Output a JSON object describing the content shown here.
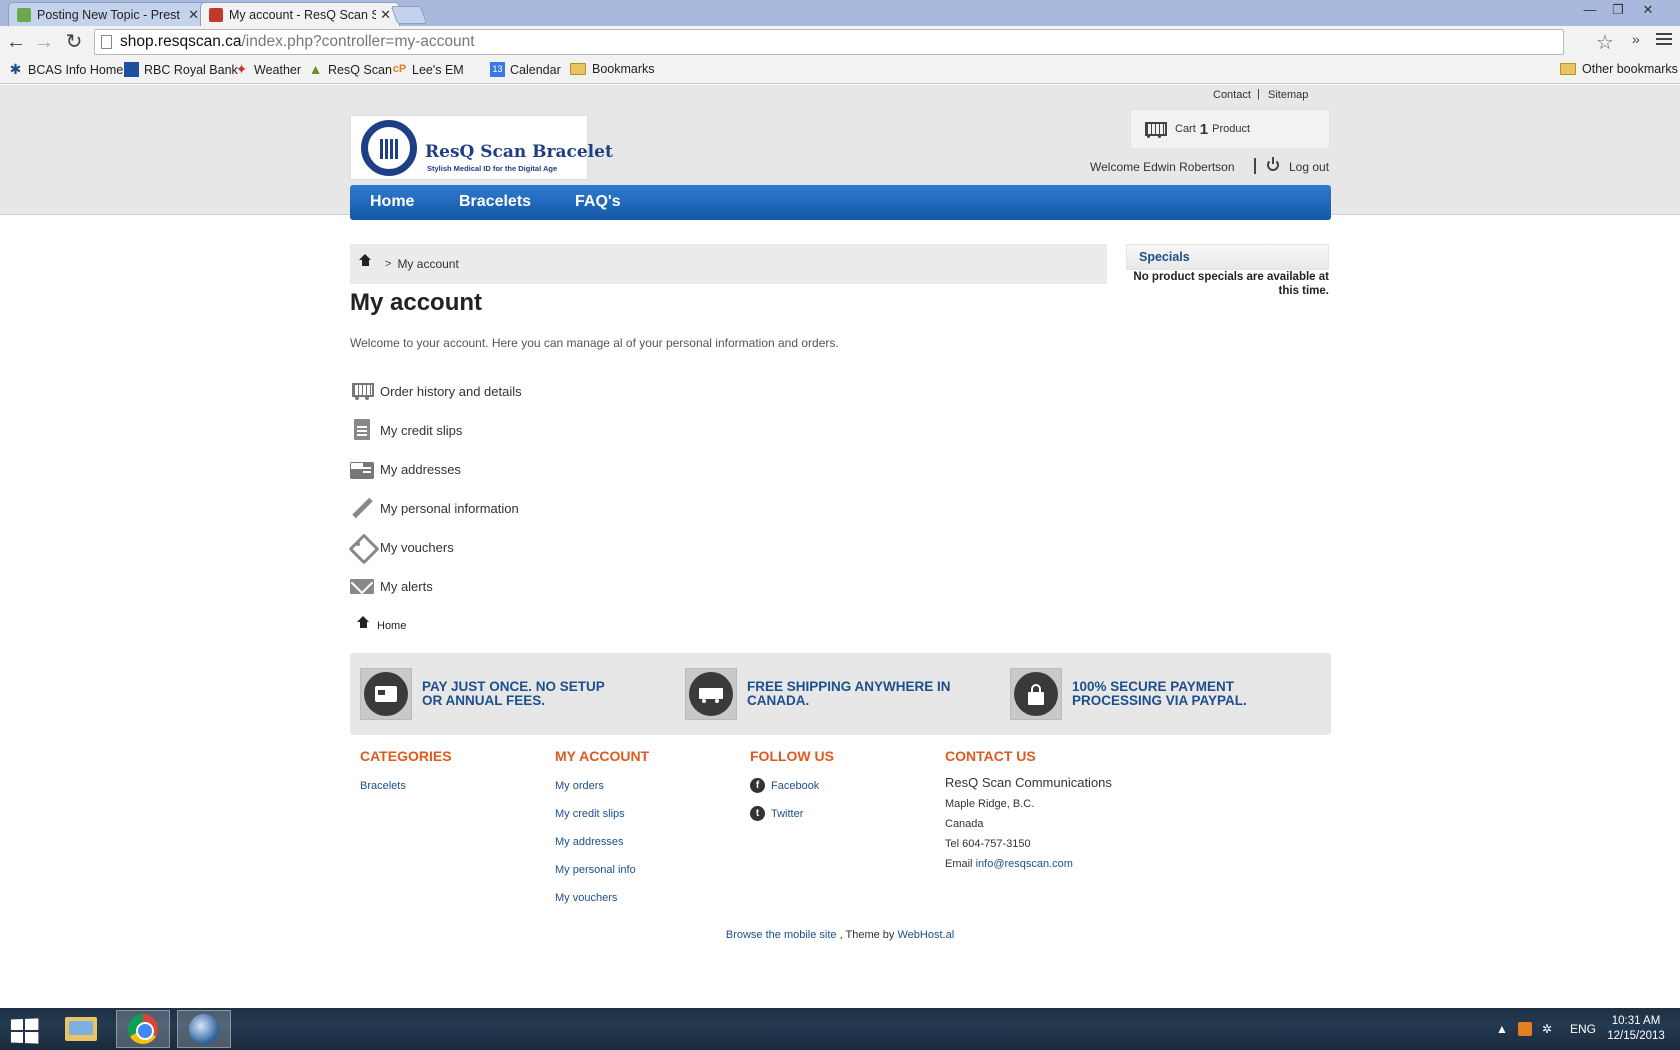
{
  "browser": {
    "tabs": [
      {
        "title": "Posting New Topic - Prest",
        "active": false
      },
      {
        "title": "My account - ResQ Scan S",
        "active": true
      }
    ],
    "url": {
      "host": "shop.resqscan.ca",
      "path": "/index.php?controller=my-account"
    },
    "bookmarks": [
      "BCAS Info Home",
      "RBC Royal Bank",
      "Weather",
      "ResQ Scan",
      "Lee's EM",
      "Calendar",
      "Bookmarks"
    ],
    "other_bookmarks": "Other bookmarks"
  },
  "header": {
    "links": {
      "contact": "Contact",
      "separator": "|",
      "sitemap": "Sitemap"
    },
    "logo": {
      "title": "ResQ Scan Bracelet",
      "tagline": "Stylish Medical ID for the Digital Age"
    },
    "cart": {
      "label": "Cart",
      "count": "1",
      "unit": "Product"
    },
    "welcome": "Welcome Edwin Robertson",
    "logout": "Log out"
  },
  "nav": {
    "items": [
      "Home",
      "Bracelets",
      "FAQ's"
    ]
  },
  "breadcrumb": {
    "separator": ">",
    "current": "My account"
  },
  "main": {
    "title": "My account",
    "intro": "Welcome to your account. Here you can manage al of your personal information and orders.",
    "items": [
      {
        "label": "Order history and details",
        "icon": "cart-icon"
      },
      {
        "label": "My credit slips",
        "icon": "document-icon"
      },
      {
        "label": "My addresses",
        "icon": "address-card-icon"
      },
      {
        "label": "My personal information",
        "icon": "pencil-icon"
      },
      {
        "label": "My vouchers",
        "icon": "tag-icon"
      },
      {
        "label": "My alerts",
        "icon": "envelope-icon"
      }
    ],
    "bottom_home": "Home"
  },
  "specials": {
    "title": "Specials",
    "text_line1": "No product specials are available at",
    "text_line2": "this time."
  },
  "reassurance": [
    {
      "line1": "PAY JUST ONCE. NO SETUP",
      "line2": "OR ANNUAL FEES.",
      "icon": "credit-card-icon"
    },
    {
      "line1": "FREE SHIPPING ANYWHERE IN",
      "line2": "CANADA.",
      "icon": "truck-icon"
    },
    {
      "line1": "100% SECURE PAYMENT",
      "line2": "PROCESSING VIA PAYPAL.",
      "icon": "lock-icon"
    }
  ],
  "footer": {
    "categories": {
      "title": "CATEGORIES",
      "links": [
        "Bracelets"
      ]
    },
    "account": {
      "title": "MY ACCOUNT",
      "links": [
        "My orders",
        "My credit slips",
        "My addresses",
        "My personal info",
        "My vouchers"
      ]
    },
    "follow": {
      "title": "FOLLOW US",
      "links": [
        "Facebook",
        "Twitter"
      ]
    },
    "contact": {
      "title": "CONTACT US",
      "company": "ResQ Scan Communications",
      "city": "Maple Ridge, B.C.",
      "country": "Canada",
      "tel": "Tel 604-757-3150",
      "email_label": "Email",
      "email": "info@resqscan.com"
    },
    "bottom": {
      "mobile": "Browse the mobile site",
      "middle": ", Theme by",
      "theme": "WebHost.al"
    }
  },
  "taskbar": {
    "lang": "ENG",
    "time": "10:31 AM",
    "date": "12/15/2013"
  }
}
